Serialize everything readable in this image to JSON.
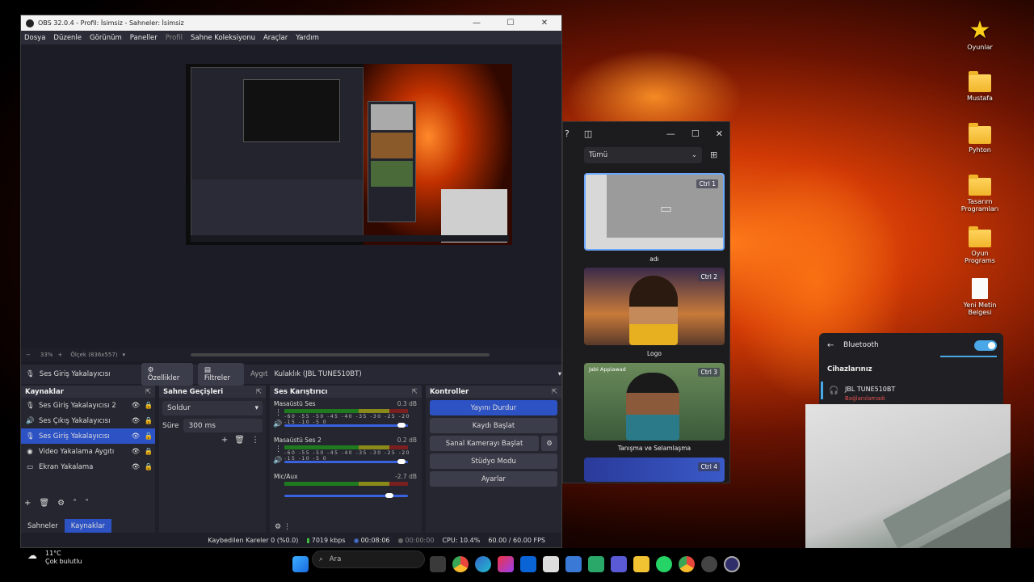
{
  "desktop": {
    "icons": [
      {
        "label": "Oyunlar",
        "icon": "star-icon"
      },
      {
        "label": "Mustafa",
        "icon": "folder-icon"
      },
      {
        "label": "Pyhton",
        "icon": "folder-icon"
      },
      {
        "label": "Tasarım Programları",
        "icon": "folder-icon"
      },
      {
        "label": "Oyun Programs",
        "icon": "folder-icon"
      },
      {
        "label": "Yeni Metin Belgesi",
        "icon": "document-icon"
      }
    ]
  },
  "obs": {
    "title": "OBS 32.0.4 - Profil: İsimsiz - Sahneler: İsimsiz",
    "menu": [
      "Dosya",
      "Düzenle",
      "Görünüm",
      "Paneller",
      "Profil",
      "Sahne Koleksiyonu",
      "Araçlar",
      "Yardım"
    ],
    "zoom": "33%",
    "scale": "Ölçek (836x557)",
    "source_toolbar": {
      "selected_source": "Ses Giriş Yakalayıcısı",
      "properties": "Özellikler",
      "filters": "Filtreler",
      "device_label": "Aygıt",
      "device_value": "Kulaklık (JBL TUNE510BT)"
    },
    "sources_panel": {
      "title": "Kaynaklar",
      "items": [
        {
          "label": "Ses Giriş Yakalayıcısı 2"
        },
        {
          "label": "Ses Çıkış Yakalayıcısı"
        },
        {
          "label": "Ses Giriş Yakalayıcısı"
        },
        {
          "label": "Video Yakalama Aygıtı"
        },
        {
          "label": "Ekran Yakalama"
        }
      ],
      "tabs": [
        "Sahneler",
        "Kaynaklar"
      ]
    },
    "transitions": {
      "title": "Sahne Geçişleri",
      "type": "Soldur",
      "duration_label": "Süre",
      "duration_value": "300 ms"
    },
    "mixer": {
      "title": "Ses Karıştırıcı",
      "scale": "-60 -55 -50 -45 -40 -35 -30 -25 -20 -15 -10 -5 0",
      "channels": [
        {
          "name": "Masaüstü Ses",
          "db": "0.3 dB",
          "level": 0.95
        },
        {
          "name": "Masaüstü Ses 2",
          "db": "0.2 dB",
          "level": 0.95
        },
        {
          "name": "Mic/Aux",
          "db": "-2.7 dB",
          "level": 0.85
        }
      ]
    },
    "controls": {
      "title": "Kontroller",
      "buttons": [
        "Yayını Durdur",
        "Kaydı Başlat",
        "Sanal Kamerayı Başlat",
        "Stüdyo Modu",
        "Ayarlar"
      ]
    },
    "status": {
      "dropped": "Kaybedilen Kareler 0 (%0.0)",
      "bitrate": "7019 kbps",
      "stream_time": "00:08:06",
      "rec_time": "00:00:00",
      "cpu": "CPU: 10.4%",
      "fps": "60.00 / 60.00 FPS"
    }
  },
  "snap": {
    "filter": "Tümü",
    "cards": [
      {
        "label": "adı",
        "shortcut": "Ctrl 1"
      },
      {
        "label": "Logo",
        "shortcut": "Ctrl 2"
      },
      {
        "label": "Tanışma ve Selamlaşma",
        "shortcut": "Ctrl 3",
        "caption": "Jabi Appiawad"
      },
      {
        "label": "",
        "shortcut": "Ctrl 4"
      }
    ]
  },
  "bluetooth": {
    "title": "Bluetooth",
    "section": "Cihazlarınız",
    "device": "JBL TUNE510BT",
    "device_status": "Bağlanılamadı"
  },
  "taskbar": {
    "weather_temp": "11°C",
    "weather_desc": "Çok bulutlu",
    "search_placeholder": "Ara"
  }
}
